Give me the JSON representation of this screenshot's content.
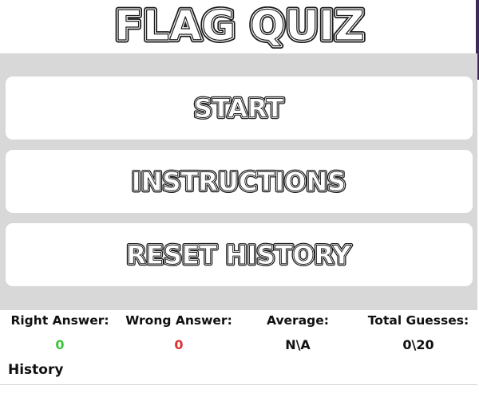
{
  "app": {
    "title": "FLAG QUIZ"
  },
  "menu": {
    "start_label": "START",
    "instructions_label": "INSTRUCTIONS",
    "reset_label": "RESET HISTORY"
  },
  "stats": {
    "right": {
      "label": "Right Answer:",
      "value": "0"
    },
    "wrong": {
      "label": "Wrong Answer:",
      "value": "0"
    },
    "average": {
      "label": "Average:",
      "value": "N\\A"
    },
    "total": {
      "label": "Total Guesses:",
      "value": "0\\20"
    }
  },
  "history": {
    "label": "History"
  },
  "colors": {
    "menu_background": "#d8d8d8",
    "right_value": "#3cc43c",
    "wrong_value": "#e03030",
    "outline_text": "#1a1a1a",
    "edge_accent": "#3b2a5a"
  }
}
